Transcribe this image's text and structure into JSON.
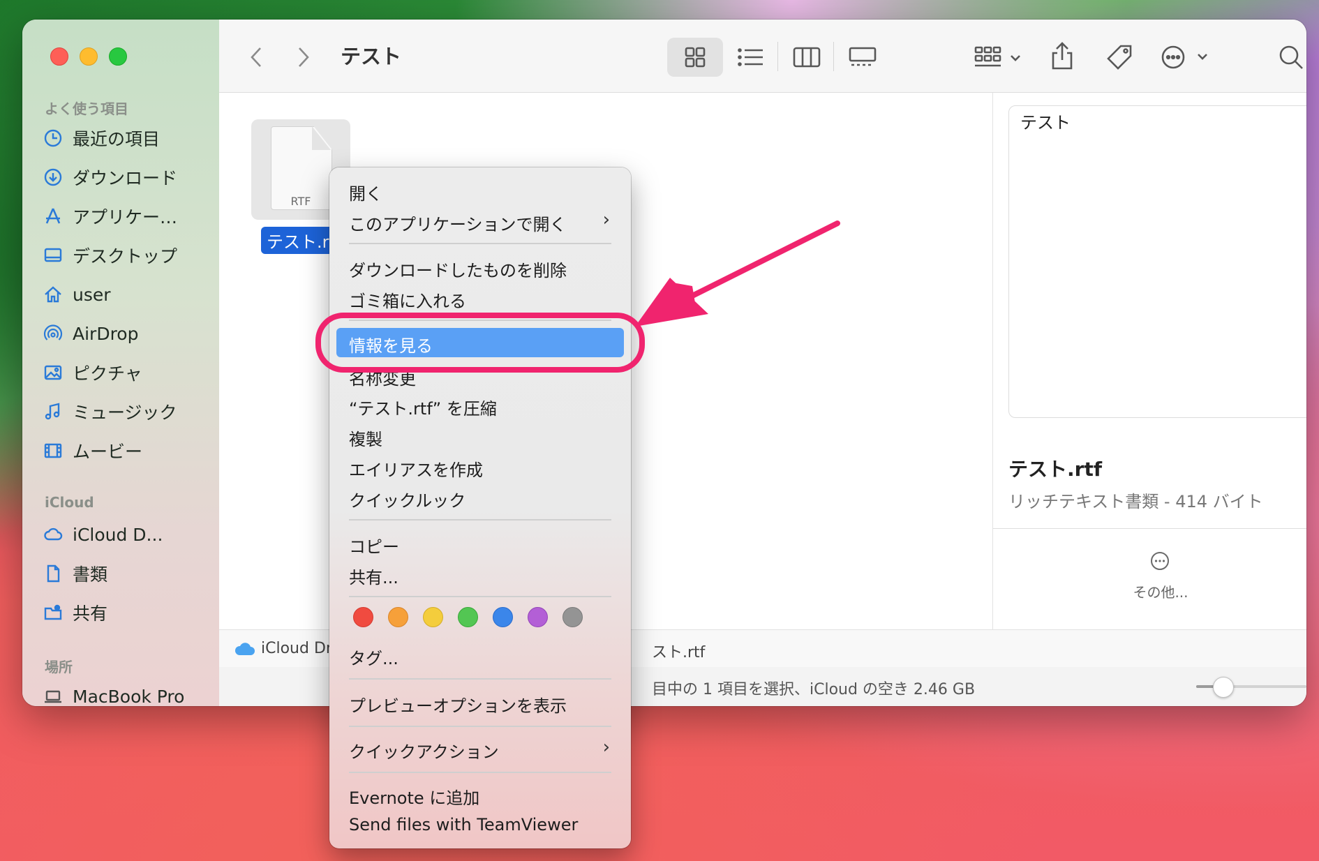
{
  "window": {
    "title": "テスト"
  },
  "sidebar": {
    "favorites_header": "よく使う項目",
    "favorites": [
      {
        "label": "最近の項目",
        "icon": "clock-icon"
      },
      {
        "label": "ダウンロード",
        "icon": "download-icon"
      },
      {
        "label": "アプリケー…",
        "icon": "applications-icon"
      },
      {
        "label": "デスクトップ",
        "icon": "desktop-icon"
      },
      {
        "label": "user",
        "icon": "home-icon"
      },
      {
        "label": "AirDrop",
        "icon": "airdrop-icon"
      },
      {
        "label": "ピクチャ",
        "icon": "pictures-icon"
      },
      {
        "label": "ミュージック",
        "icon": "music-icon"
      },
      {
        "label": "ムービー",
        "icon": "movies-icon"
      }
    ],
    "icloud_header": "iCloud",
    "icloud": [
      {
        "label": "iCloud D...",
        "icon": "cloud-icon"
      },
      {
        "label": "書類",
        "icon": "document-icon"
      },
      {
        "label": "共有",
        "icon": "shared-folder-icon"
      }
    ],
    "locations_header": "場所",
    "locations": [
      {
        "label": "MacBook Pro",
        "icon": "laptop-icon"
      }
    ]
  },
  "file": {
    "name": "テスト.rt",
    "ext_label": "RTF"
  },
  "preview": {
    "content_text": "テスト",
    "name": "テスト.rtf",
    "kind": "リッチテキスト書類 - 414 バイト",
    "more_label": "その他..."
  },
  "pathbar": {
    "root": "iCloud Dr",
    "file": "スト.rtf"
  },
  "statusbar": {
    "text": "目中の 1 項目を選択、iCloud の空き 2.46 GB",
    "zoom": 0.2
  },
  "context_menu": {
    "open": "開く",
    "open_with": "このアプリケーションで開く",
    "remove_download": "ダウンロードしたものを削除",
    "move_to_trash": "ゴミ箱に入れる",
    "get_info": "情報を見る",
    "rename": "名称変更",
    "compress": "“テスト.rtf” を圧縮",
    "duplicate": "複製",
    "make_alias": "エイリアスを作成",
    "quick_look": "クイックルック",
    "copy": "コピー",
    "share": "共有...",
    "tags_label": "タグ...",
    "tag_colors": [
      "#f04b40",
      "#f6a03a",
      "#f4cd3c",
      "#53c653",
      "#3b86ea",
      "#b35fd6",
      "#949494"
    ],
    "show_preview_options": "プレビューオプションを表示",
    "quick_actions": "クイックアクション",
    "evernote": "Evernote に追加",
    "teamviewer": "Send files with TeamViewer"
  },
  "annotation": {
    "color": "#f0246e"
  }
}
